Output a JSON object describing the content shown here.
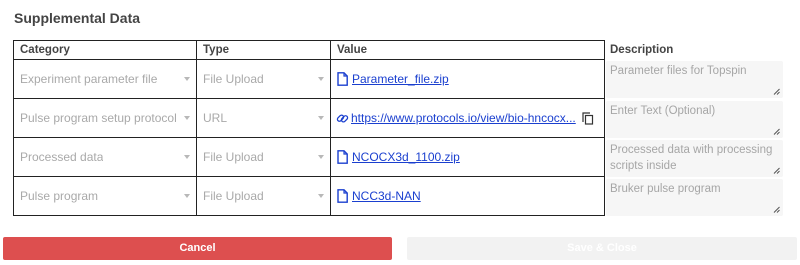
{
  "title": "Supplemental Data",
  "columns": {
    "category": "Category",
    "type": "Type",
    "value": "Value",
    "description": "Description"
  },
  "rows": [
    {
      "category": "Experiment parameter file",
      "type": "File Upload",
      "value": "Parameter_file.zip",
      "value_kind": "file",
      "description": "Parameter files for Topspin"
    },
    {
      "category": "Pulse program setup protocol",
      "type": "URL",
      "value": "https://www.protocols.io/view/bio-hncocx...",
      "value_kind": "url",
      "description": "Enter Text (Optional)"
    },
    {
      "category": "Processed data",
      "type": "File Upload",
      "value": "NCOCX3d_1100.zip",
      "value_kind": "file",
      "description": "Processed data with processing scripts inside"
    },
    {
      "category": "Pulse program",
      "type": "File Upload",
      "value": "NCC3d-NAN",
      "value_kind": "file",
      "description": "Bruker pulse program"
    }
  ],
  "buttons": {
    "cancel": "Cancel",
    "save": "Save & Close"
  },
  "colors": {
    "cancel_bg": "#dd4f4f",
    "link": "#1a3fcf",
    "placeholder": "#a9a9a9"
  },
  "icons": {
    "file": "document-icon",
    "url": "link-icon",
    "copy": "copy-icon",
    "dropdown": "caret-down-icon"
  }
}
